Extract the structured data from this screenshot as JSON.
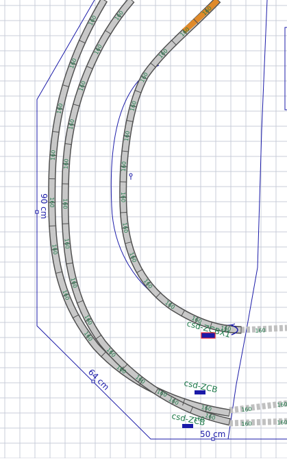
{
  "canvas": {
    "background": "#ffffff",
    "grid_color": "#c8ccd8",
    "outline_color": "#1a1aa8",
    "track_fill": "#c8c8c8",
    "track_stroke": "#505050",
    "label_color": "#1f7a4a",
    "highlight_color": "#e08a2a"
  },
  "dimensions": {
    "height_label": "90 cm",
    "diagonal_label": "64 cm",
    "bottom_label": "50 cm"
  },
  "track_labels": {
    "left_outer": [
      "160",
      "160",
      "160",
      "160",
      "160",
      "160",
      "160",
      "160",
      "160",
      "160",
      "160"
    ],
    "left_inner": [
      "160",
      "160",
      "160",
      "160",
      "160",
      "160",
      "160",
      "160",
      "160",
      "160",
      "160",
      "160",
      "160"
    ],
    "inner_loop": [
      "160",
      "160",
      "160",
      "160",
      "160",
      "160",
      "160",
      "160",
      "160",
      "160",
      "160",
      "160",
      "160",
      "160"
    ],
    "right_side": [
      "160",
      "160",
      "160",
      "160",
      "160",
      "160",
      "160"
    ]
  },
  "stations": {
    "top": "csd-ZCBX1",
    "middle": "csd-ZCB",
    "bottom": "csd-ZCB"
  }
}
